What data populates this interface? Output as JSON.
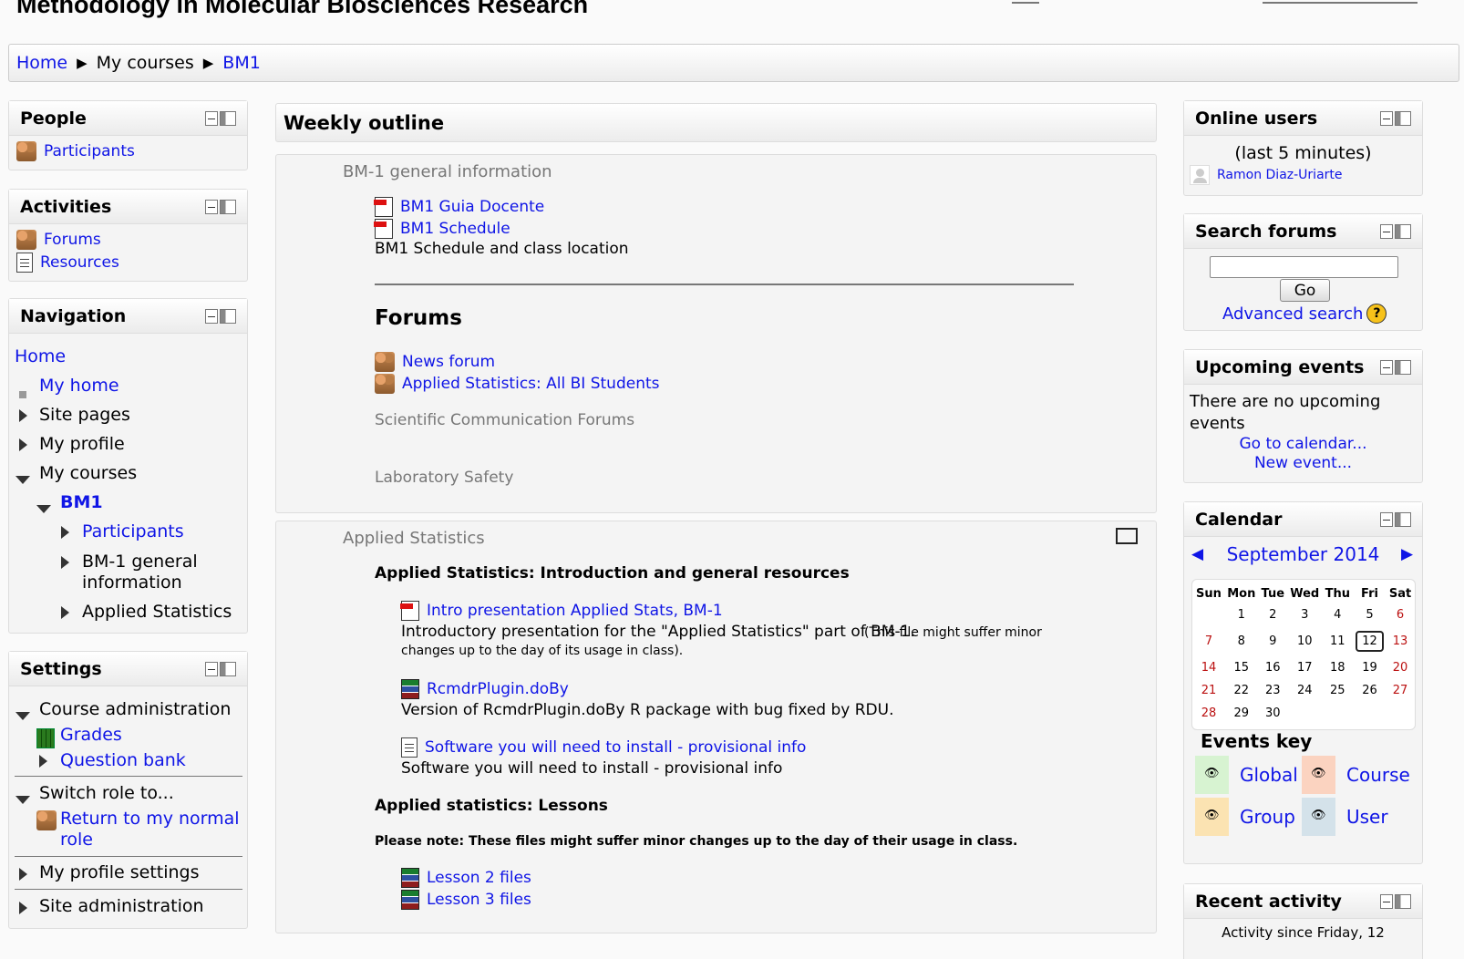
{
  "page": {
    "title": "Methodology in Molecular Biosciences Research"
  },
  "breadcrumb": {
    "home": "Home",
    "sep": "▶",
    "my_courses": "My courses",
    "current": "BM1"
  },
  "people": {
    "title": "People",
    "participants": "Participants"
  },
  "activities": {
    "title": "Activities",
    "forums": "Forums",
    "resources": "Resources"
  },
  "navigation": {
    "title": "Navigation",
    "home": "Home",
    "my_home": "My home",
    "site_pages": "Site pages",
    "my_profile": "My profile",
    "my_courses": "My courses",
    "bm1": "BM1",
    "participants": "Participants",
    "bm1_general_line1": "BM-1 general",
    "bm1_general_line2": "information",
    "applied_statistics": "Applied Statistics"
  },
  "settings": {
    "title": "Settings",
    "course_admin": "Course administration",
    "grades": "Grades",
    "question_bank": "Question bank",
    "switch_role": "Switch role to...",
    "return_normal_line1": "Return to my normal",
    "return_normal_line2": "role",
    "my_profile_settings": "My profile settings",
    "site_admin": "Site administration"
  },
  "main": {
    "header": "Weekly outline",
    "section0": {
      "name": "BM-1 general information",
      "guia": "BM1 Guia Docente",
      "schedule": "BM1 Schedule",
      "schedule_desc": "BM1 Schedule and class location",
      "forums_heading": "Forums",
      "news_forum": "News forum",
      "applied_forum": "Applied Statistics: All BI Students",
      "sci_comm": "Scientific Communication Forums",
      "lab_safety": "Laboratory Safety"
    },
    "section1": {
      "name": "Applied Statistics",
      "intro_heading": "Applied Statistics: Introduction and general resources",
      "intro_link": "Intro presentation Applied Stats, BM-1",
      "intro_desc": "Introductory presentation for the \"Applied Statistics\" part of BM-1.",
      "intro_note_line1": "(This file might suffer minor",
      "intro_note_line2": "changes up to the day of its usage in class).",
      "rcmdr_link": "RcmdrPlugin.doBy",
      "rcmdr_desc": "Version of RcmdrPlugin.doBy R package with bug fixed by RDU.",
      "software_link": "Software you will need to install - provisional info",
      "software_desc": "Software you will need to install - provisional info",
      "lessons_heading": "Applied statistics: Lessons",
      "lessons_note": "Please note: These files might suffer minor changes up to the day of their usage in class.",
      "lesson2": "Lesson 2 files",
      "lesson3": "Lesson 3 files"
    }
  },
  "online_users": {
    "title": "Online users",
    "subtitle": "(last 5 minutes)",
    "user": "Ramon Diaz-Uriarte"
  },
  "search_forums": {
    "title": "Search forums",
    "go": "Go",
    "advanced": "Advanced search",
    "help": "?",
    "value": ""
  },
  "upcoming": {
    "title": "Upcoming events",
    "none_line1": "There are no upcoming",
    "none_line2": "events",
    "go_calendar": "Go to calendar...",
    "new_event": "New event..."
  },
  "calendar": {
    "title": "Calendar",
    "prev": "◀",
    "next": "▶",
    "month": "September 2014",
    "days": [
      "Sun",
      "Mon",
      "Tue",
      "Wed",
      "Thu",
      "Fri",
      "Sat"
    ],
    "weeks": [
      [
        "",
        "1",
        "2",
        "3",
        "4",
        "5",
        "6"
      ],
      [
        "7",
        "8",
        "9",
        "10",
        "11",
        "12",
        "13"
      ],
      [
        "14",
        "15",
        "16",
        "17",
        "18",
        "19",
        "20"
      ],
      [
        "21",
        "22",
        "23",
        "24",
        "25",
        "26",
        "27"
      ],
      [
        "28",
        "29",
        "30",
        "",
        "",
        "",
        ""
      ]
    ],
    "today": "12",
    "events_key_title": "Events key",
    "key": {
      "global": "Global",
      "course": "Course",
      "group": "Group",
      "user": "User"
    },
    "colors": {
      "global": "#d7f3d1",
      "course": "#fbd3c0",
      "group": "#fbe3b2",
      "user": "#d4e2ea",
      "weekend": "#bb1111",
      "link": "#0f15e6"
    }
  },
  "recent_activity": {
    "title": "Recent activity",
    "since": "Activity since Friday, 12"
  }
}
